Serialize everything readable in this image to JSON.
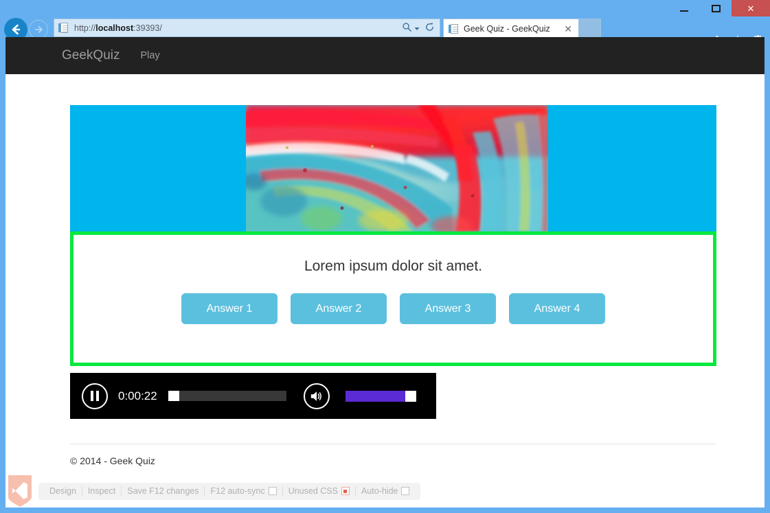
{
  "window": {
    "controls": {
      "minimize": "minimize-button",
      "maximize": "maximize-button",
      "close": "✕"
    },
    "frame_color": "#65AFF0",
    "close_color": "#C75050"
  },
  "browser": {
    "back_glyph": "←",
    "forward_glyph": "→",
    "address": {
      "url_prefix": "http://",
      "host": "localhost",
      "port_path": ":39393/",
      "full_url": "http://localhost:39393/"
    },
    "address_actions": {
      "search_glyph": "⌕",
      "search_dropdown_glyph": "▾",
      "refresh_glyph": "↻"
    },
    "tab": {
      "title": "Geek Quiz - GeekQuiz",
      "close_glyph": "✕"
    },
    "toolbar_icons": [
      "home-icon",
      "favorites-star-icon",
      "tools-gear-icon"
    ]
  },
  "site": {
    "navbar": {
      "brand": "GeekQuiz",
      "links": [
        {
          "label": "Play"
        }
      ],
      "background": "#222222",
      "text_color": "#9d9d9d"
    },
    "quiz": {
      "banner_background": "#00B4EC",
      "highlight_border_color": "#07E83F",
      "question": "Lorem ipsum dolor sit amet.",
      "answers": [
        {
          "label": "Answer 1"
        },
        {
          "label": "Answer 2"
        },
        {
          "label": "Answer 3"
        },
        {
          "label": "Answer 4"
        }
      ],
      "answer_color": "#5BC0DE"
    },
    "player": {
      "state": "playing",
      "pause_icon": "pause-icon",
      "time": "0:00:22",
      "seek_percent": 2,
      "volume_icon": "speaker-icon",
      "volume_percent": 85,
      "volume_color": "#5B2BD4",
      "track_color": "#383838",
      "background": "#000000"
    },
    "footer": {
      "copyright": "© 2014 - Geek Quiz"
    }
  },
  "devbar": {
    "logo": "visual-studio-logo",
    "items": [
      {
        "label": "Design",
        "type": "button"
      },
      {
        "label": "Inspect",
        "type": "button"
      },
      {
        "label": "Save F12 changes",
        "type": "button"
      },
      {
        "label": "F12 auto-sync",
        "type": "checkbox",
        "checked": false
      },
      {
        "label": "Unused CSS",
        "type": "record",
        "active": false
      },
      {
        "label": "Auto-hide",
        "type": "checkbox",
        "checked": false
      }
    ]
  }
}
